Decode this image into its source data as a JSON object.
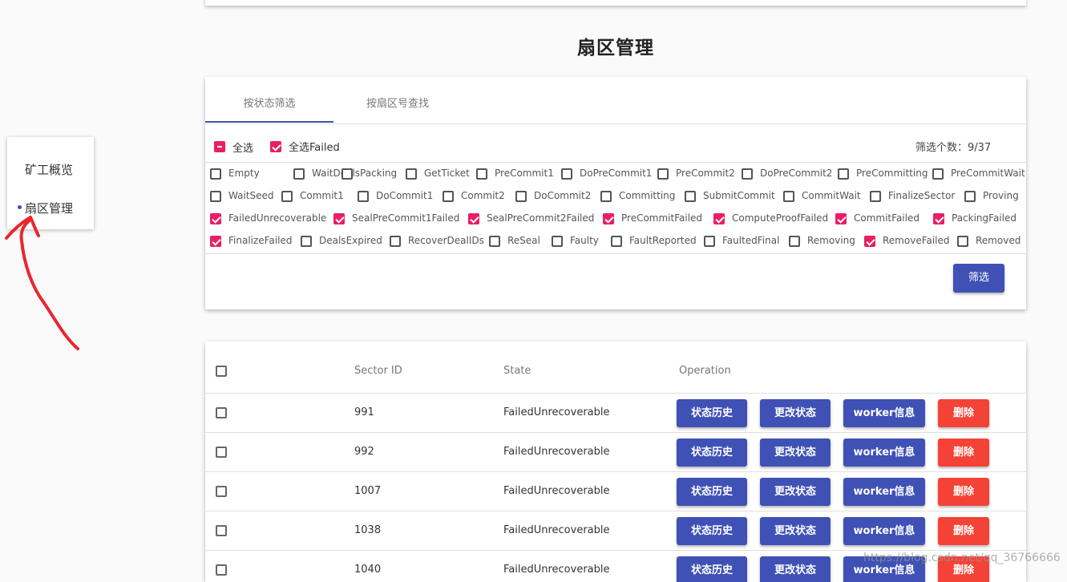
{
  "page": {
    "title": "扇区管理",
    "watermark": "https://blog.csdn.net/qq_36766666"
  },
  "sidebar": {
    "items": [
      {
        "label": "矿工概览",
        "active": false
      },
      {
        "label": "扇区管理",
        "active": true
      }
    ]
  },
  "filter": {
    "tabs": [
      {
        "label": "按状态筛选",
        "active": true
      },
      {
        "label": "按扇区号查找",
        "active": false
      }
    ],
    "select_all_label": "全选",
    "select_all_state": "indeterminate",
    "select_failed_label": "全选Failed",
    "select_failed_checked": true,
    "count_label": "筛选个数：9/37",
    "states": [
      {
        "label": "Empty",
        "checked": false
      },
      {
        "label": "WaitDeals",
        "checked": false
      },
      {
        "label": "Packing",
        "checked": false
      },
      {
        "label": "GetTicket",
        "checked": false
      },
      {
        "label": "PreCommit1",
        "checked": false
      },
      {
        "label": "DoPreCommit1",
        "checked": false
      },
      {
        "label": "PreCommit2",
        "checked": false
      },
      {
        "label": "DoPreCommit2",
        "checked": false
      },
      {
        "label": "PreCommitting",
        "checked": false
      },
      {
        "label": "PreCommitWait",
        "checked": false
      },
      {
        "label": "WaitSeed",
        "checked": false
      },
      {
        "label": "Commit1",
        "checked": false
      },
      {
        "label": "DoCommit1",
        "checked": false
      },
      {
        "label": "Commit2",
        "checked": false
      },
      {
        "label": "DoCommit2",
        "checked": false
      },
      {
        "label": "Committing",
        "checked": false
      },
      {
        "label": "SubmitCommit",
        "checked": false
      },
      {
        "label": "CommitWait",
        "checked": false
      },
      {
        "label": "FinalizeSector",
        "checked": false
      },
      {
        "label": "Proving",
        "checked": false
      },
      {
        "label": "FailedUnrecoverable",
        "checked": true
      },
      {
        "label": "SealPreCommit1Failed",
        "checked": true
      },
      {
        "label": "SealPreCommit2Failed",
        "checked": true
      },
      {
        "label": "PreCommitFailed",
        "checked": true
      },
      {
        "label": "ComputeProofFailed",
        "checked": true
      },
      {
        "label": "CommitFailed",
        "checked": true
      },
      {
        "label": "PackingFailed",
        "checked": true
      },
      {
        "label": "FinalizeFailed",
        "checked": true
      },
      {
        "label": "DealsExpired",
        "checked": false
      },
      {
        "label": "RecoverDealIDs",
        "checked": false
      },
      {
        "label": "ReSeal",
        "checked": false
      },
      {
        "label": "Faulty",
        "checked": false
      },
      {
        "label": "FaultReported",
        "checked": false
      },
      {
        "label": "FaultedFinal",
        "checked": false
      },
      {
        "label": "Removing",
        "checked": false
      },
      {
        "label": "RemoveFailed",
        "checked": true
      },
      {
        "label": "Removed",
        "checked": false
      }
    ],
    "filter_button": "筛选"
  },
  "table": {
    "headers": {
      "sector_id": "Sector ID",
      "state": "State",
      "operation": "Operation"
    },
    "actions": {
      "history": "状态历史",
      "change": "更改状态",
      "worker": "worker信息",
      "delete": "删除"
    },
    "rows": [
      {
        "sector_id": "991",
        "state": "FailedUnrecoverable"
      },
      {
        "sector_id": "992",
        "state": "FailedUnrecoverable"
      },
      {
        "sector_id": "1007",
        "state": "FailedUnrecoverable"
      },
      {
        "sector_id": "1038",
        "state": "FailedUnrecoverable"
      },
      {
        "sector_id": "1040",
        "state": "FailedUnrecoverable"
      }
    ]
  },
  "colors": {
    "primary": "#3f51b5",
    "accent": "#e91e63",
    "danger": "#f44336",
    "annotation": "#e8272e"
  },
  "icons": [
    "checkbox-icon",
    "checkbox-checked-icon",
    "checkbox-indeterminate-icon",
    "nav-dot-icon"
  ]
}
